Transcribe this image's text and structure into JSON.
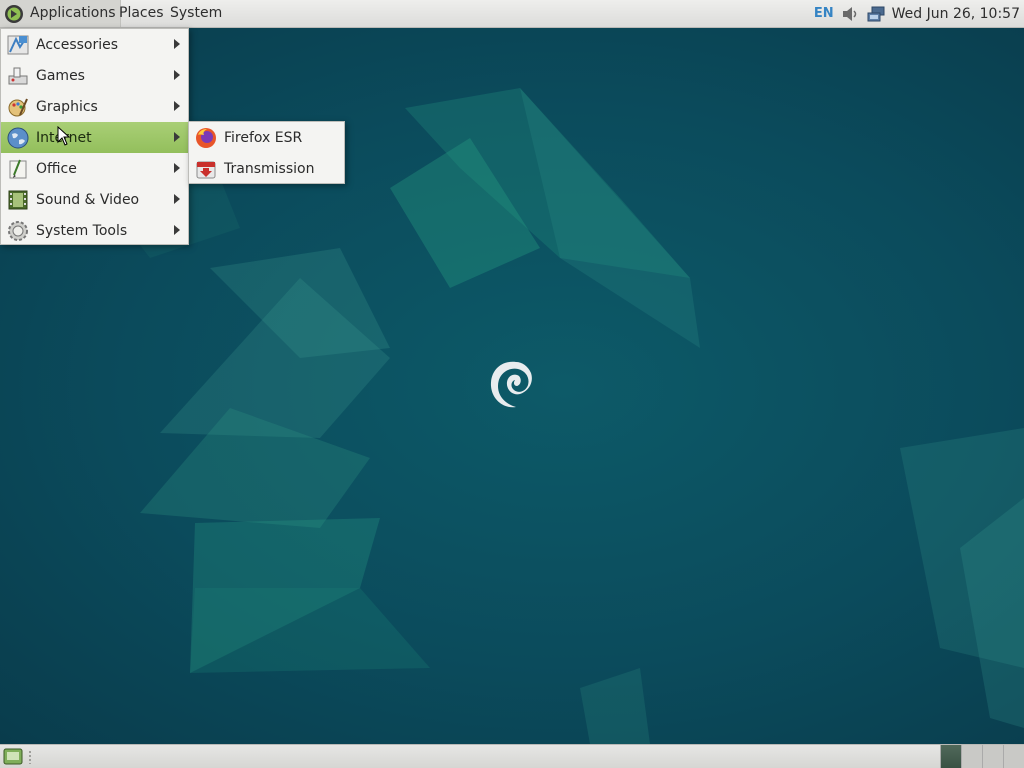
{
  "top_panel": {
    "applications_label": "Applications",
    "places_label": "Places",
    "system_label": "System",
    "menu_logo_icon": "gnome-foot-icon",
    "tray": {
      "keyboard_layout": "EN",
      "volume_icon": "speaker-icon",
      "network_icon": "network-wired-icon",
      "clock": "Wed Jun 26, 10:57"
    }
  },
  "applications_menu": {
    "items": [
      {
        "label": "Accessories",
        "icon": "accessories-icon"
      },
      {
        "label": "Games",
        "icon": "games-icon"
      },
      {
        "label": "Graphics",
        "icon": "graphics-icon"
      },
      {
        "label": "Internet",
        "icon": "internet-globe-icon",
        "highlighted": true
      },
      {
        "label": "Office",
        "icon": "office-icon"
      },
      {
        "label": "Sound & Video",
        "icon": "film-strip-icon"
      },
      {
        "label": "System Tools",
        "icon": "gear-icon"
      }
    ]
  },
  "internet_submenu": {
    "items": [
      {
        "label": "Firefox ESR",
        "icon": "firefox-icon"
      },
      {
        "label": "Transmission",
        "icon": "transmission-icon"
      }
    ]
  },
  "bottom_panel": {
    "show_desktop_icon": "show-desktop-icon",
    "workspaces": [
      {
        "active": true
      },
      {
        "active": false
      },
      {
        "active": false
      },
      {
        "active": false
      }
    ]
  },
  "colors": {
    "menu_highlight": "#9cc665",
    "desktop_bg": "#0b4a5a",
    "panel_bg": "#e4e4e2"
  }
}
